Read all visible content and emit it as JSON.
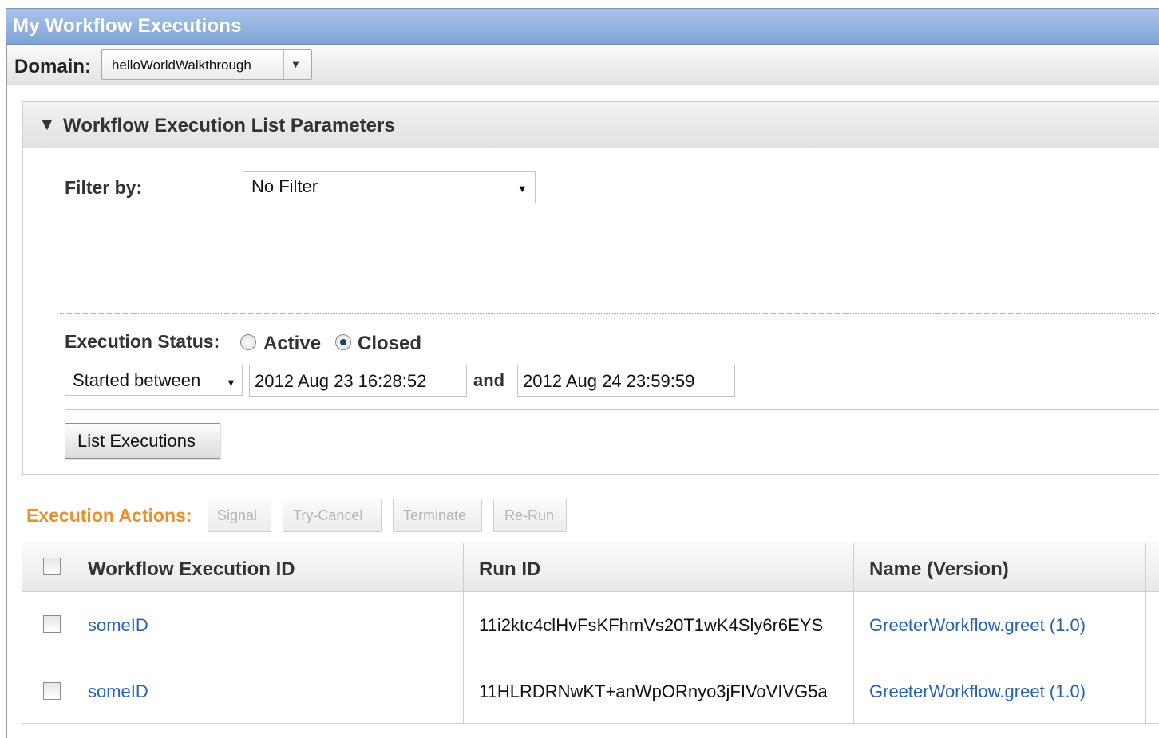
{
  "window": {
    "title": "My Workflow Executions"
  },
  "domain": {
    "label": "Domain:",
    "value": "helloWorldWalkthrough"
  },
  "parameters": {
    "title": "Workflow Execution List Parameters",
    "filter_label": "Filter by:",
    "filter_value": "No Filter",
    "status_label": "Execution Status:",
    "status_options": [
      {
        "label": "Active",
        "selected": false
      },
      {
        "label": "Closed",
        "selected": true
      }
    ],
    "time_filter": "Started between",
    "start_time": "2012 Aug 23 16:28:52",
    "and_label": "and",
    "end_time": "2012 Aug 24 23:59:59",
    "list_button": "List Executions"
  },
  "actions": {
    "label": "Execution Actions:",
    "buttons": [
      "Signal",
      "Try-Cancel",
      "Terminate",
      "Re-Run"
    ]
  },
  "table": {
    "columns": [
      "Workflow Execution ID",
      "Run ID",
      "Name (Version)"
    ],
    "rows": [
      {
        "id": "someID",
        "run_id": "11i2ktc4clHvFsKFhmVs20T1wK4Sly6r6EYS",
        "name": "GreeterWorkflow.greet (1.0)"
      },
      {
        "id": "someID",
        "run_id": "11HLRDRNwKT+anWpORnyo3jFIVoVIVG5a",
        "name": "GreeterWorkflow.greet (1.0)"
      }
    ]
  },
  "colors": {
    "title_bar": "#7fa3d6",
    "actions_label": "#e7902e",
    "link": "#2a64a8"
  }
}
